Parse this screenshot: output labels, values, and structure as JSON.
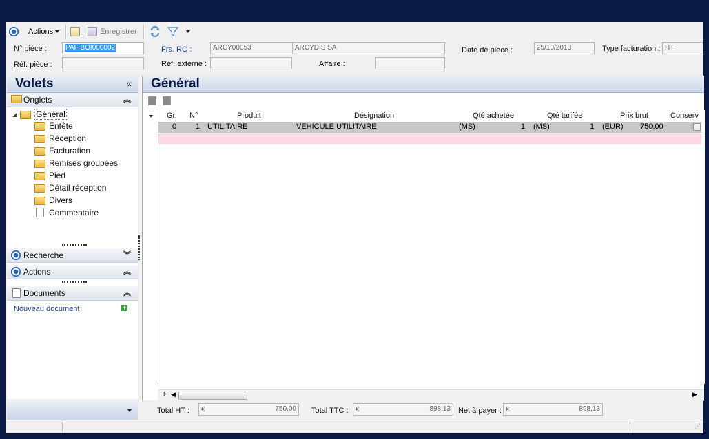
{
  "toolbar": {
    "actions_label": "Actions",
    "save_label": "Enregistrer"
  },
  "header": {
    "no_piece_label": "N° pièce :",
    "no_piece_value": "PAF BOI000002",
    "ref_piece_label": "Réf. pièce :",
    "ref_piece_value": "",
    "frs_label": "Frs. RO :",
    "frs_code": "ARCY00053",
    "frs_name": "ARCYDIS SA",
    "ref_externe_label": "Réf. externe :",
    "ref_externe_value": "",
    "affaire_label": "Affaire :",
    "affaire_value": "",
    "date_label": "Date de pièce :",
    "date_value": "25/10/2013",
    "type_label": "Type facturation :",
    "type_value": "HT"
  },
  "sidebar": {
    "title": "Volets",
    "onglets_label": "Onglets",
    "tree_root": "Général",
    "tree_items": [
      "Entête",
      "Réception",
      "Facturation",
      "Remises groupées",
      "Pied",
      "Détail réception",
      "Divers",
      "Commentaire"
    ],
    "recherche_label": "Recherche",
    "actions_label": "Actions",
    "documents_label": "Documents",
    "new_doc_label": "Nouveau document"
  },
  "main": {
    "title": "Général",
    "columns": [
      "Gr.",
      "N°",
      "Produit",
      "Désignation",
      "Qté achetée",
      "Qté tarifée",
      "Prix brut",
      "Conserv"
    ],
    "rows": [
      {
        "gr": "0",
        "no": "1",
        "produit": "UTILITAIRE",
        "designation": "VEHICULE UTILITAIRE",
        "qa_unit": "(MS)",
        "qa": "1",
        "qt_unit": "(MS)",
        "qt": "1",
        "pb_unit": "(EUR)",
        "pb": "750,00"
      }
    ]
  },
  "footer": {
    "total_ht_label": "Total HT :",
    "total_ht": "750,00",
    "total_ttc_label": "Total TTC :",
    "total_ttc": "898,13",
    "net_label": "Net à payer :",
    "net": "898,13"
  },
  "colors": {
    "background": "#0b1a45",
    "selected_row": "#c8c8c8",
    "new_row": "#fcd9e6",
    "accent": "#3399ff"
  }
}
